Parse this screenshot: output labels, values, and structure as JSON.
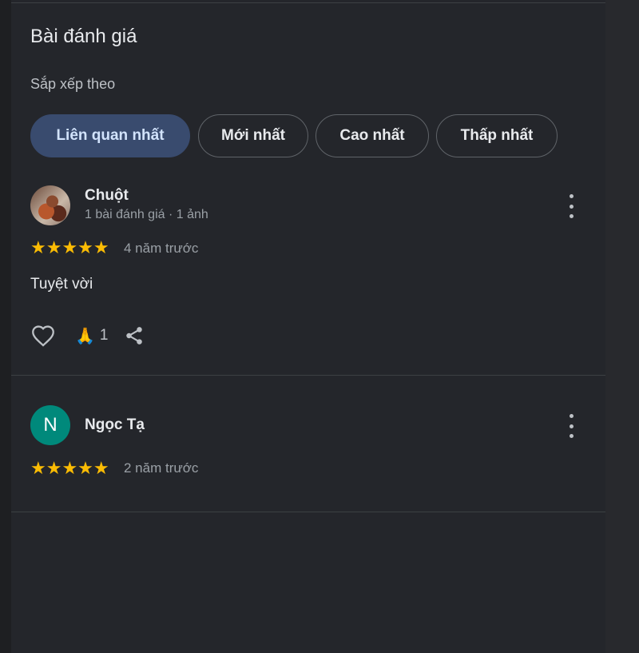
{
  "section": {
    "title": "Bài đánh giá",
    "sort_label": "Sắp xếp theo",
    "sort_chips": [
      {
        "label": "Liên quan nhất",
        "active": true
      },
      {
        "label": "Mới nhất",
        "active": false
      },
      {
        "label": "Cao nhất",
        "active": false
      },
      {
        "label": "Thấp nhất",
        "active": false
      }
    ]
  },
  "reviews": [
    {
      "author": "Chuột",
      "author_meta": "1 bài đánh giá · 1 ảnh",
      "avatar_type": "photo",
      "rating": 5,
      "stars": "★★★★★",
      "time": "4 năm trước",
      "text": "Tuyệt vời",
      "reaction_emoji": "🙏",
      "reaction_count": "1"
    },
    {
      "author": "Ngọc Tạ",
      "avatar_letter": "N",
      "avatar_color": "#00897b",
      "rating": 5,
      "stars": "★★★★★",
      "time": "2 năm trước"
    }
  ],
  "icons": {
    "like": "heart-outline-icon",
    "share": "share-icon",
    "more": "more-vert-icon",
    "star": "star-icon"
  },
  "colors": {
    "star": "#fbbc04",
    "active_chip": "#394b6e",
    "avatar_teal": "#00897b"
  }
}
